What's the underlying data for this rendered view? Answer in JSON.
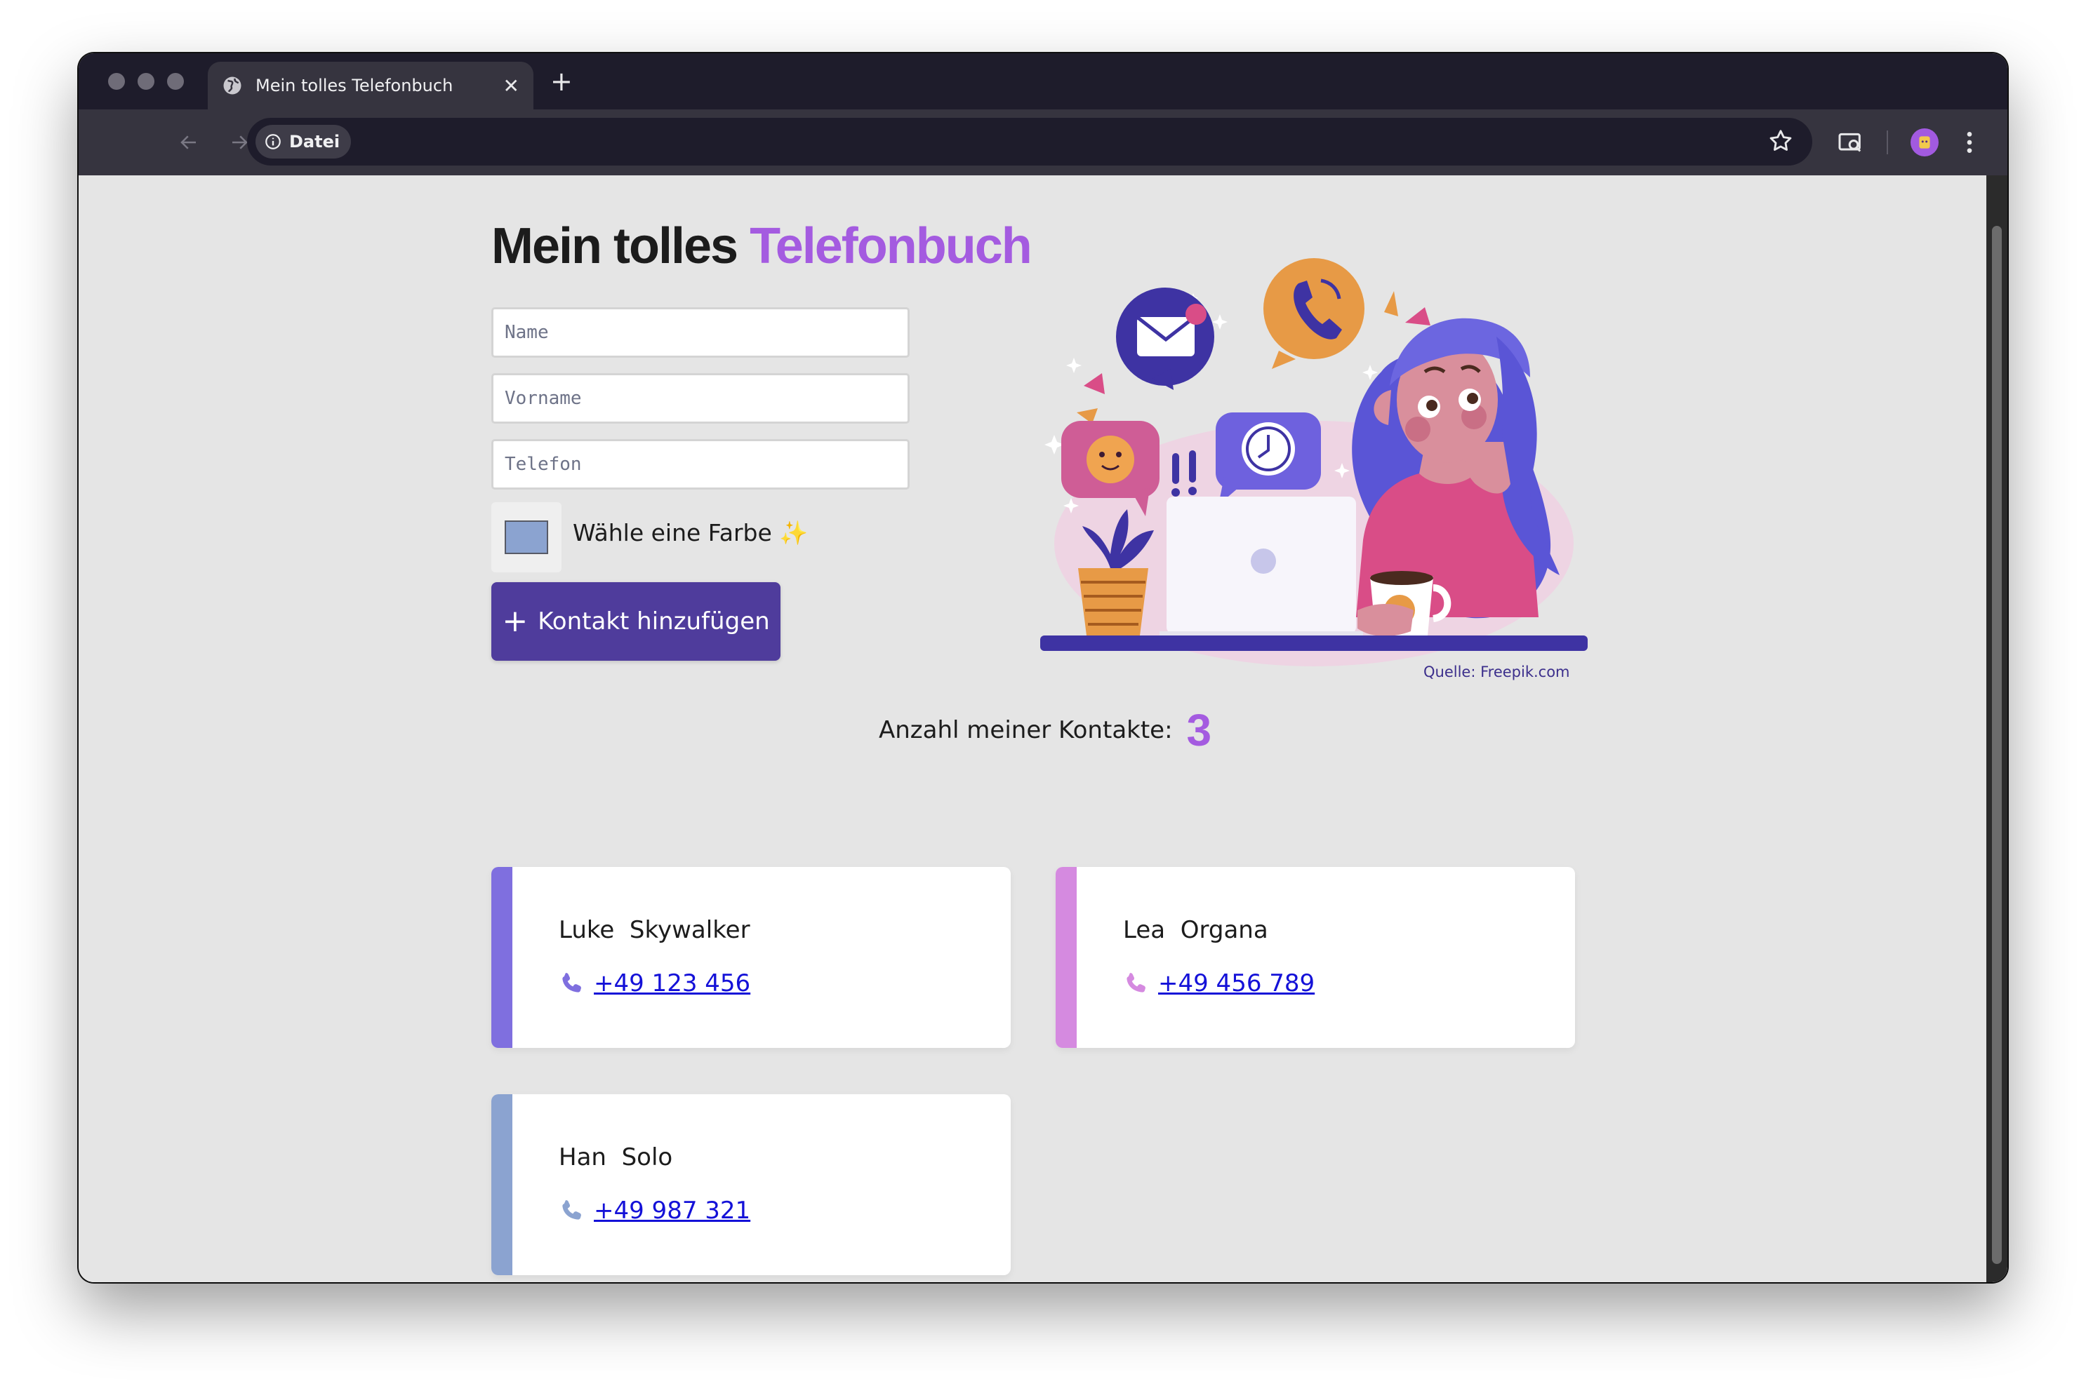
{
  "browser": {
    "tab_title": "Mein tolles Telefonbuch",
    "new_tab": "+",
    "tab_close": "✕",
    "address_chip": "Datei"
  },
  "page": {
    "heading_main": "Mein tolles",
    "heading_accent": "Telefonbuch",
    "accent_color": "#a45be0",
    "form": {
      "name_placeholder": "Name",
      "firstname_placeholder": "Vorname",
      "phone_placeholder": "Telefon",
      "color_label": "Wähle eine Farbe",
      "color_emoji": "✨",
      "color_value": "#8ba3d0",
      "add_label": "Kontakt hinzufügen",
      "add_icon": "+"
    },
    "illustration_credit": "Quelle: Freepik.com",
    "counter": {
      "label": "Anzahl meiner Kontakte:",
      "count": "3"
    },
    "contacts": [
      {
        "firstname": "Luke",
        "lastname": "Skywalker",
        "phone": "+49 123 456",
        "color": "#7f6fdf"
      },
      {
        "firstname": "Lea",
        "lastname": "Organa",
        "phone": "+49 456 789",
        "color": "#d58ae0"
      },
      {
        "firstname": "Han",
        "lastname": "Solo",
        "phone": "+49 987 321",
        "color": "#8ba3d0"
      }
    ]
  }
}
